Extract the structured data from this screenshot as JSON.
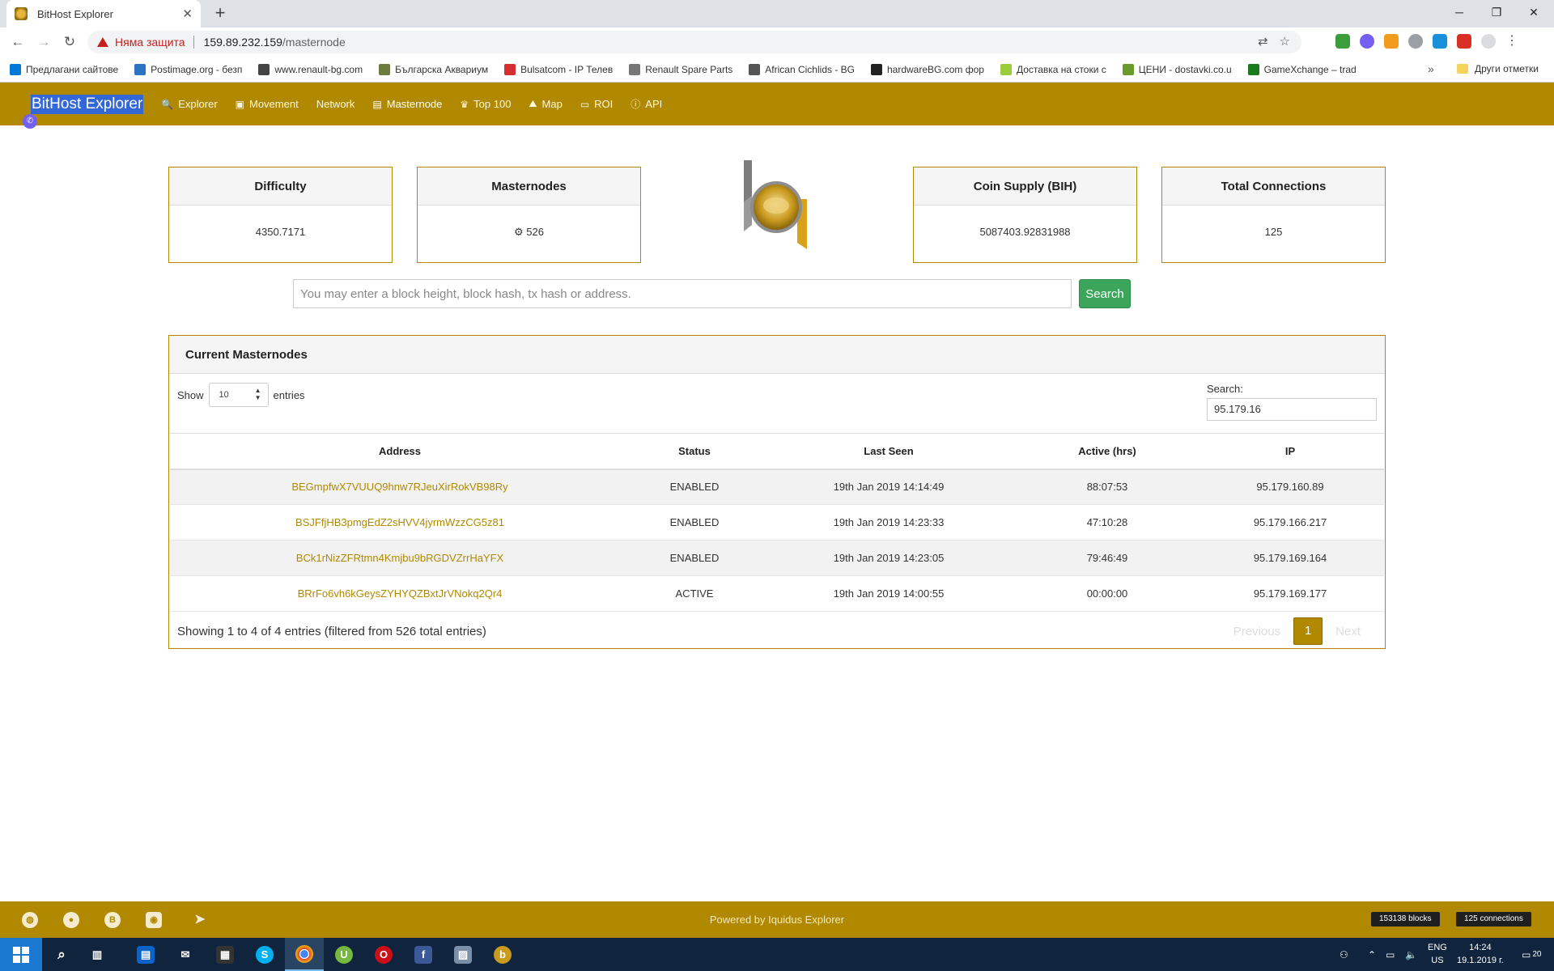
{
  "browser": {
    "tab_title": "BitHost Explorer",
    "new_tab_glyph": "+",
    "insecure_label": "Няма защита",
    "url_host": "159.89.232.159",
    "url_path": "/masternode",
    "bookmarks": [
      {
        "label": "Предлагани сайтове",
        "icon_color": "#0078d7"
      },
      {
        "label": "Postimage.org - безп",
        "icon_color": "#2a73c5"
      },
      {
        "label": "www.renault-bg.com",
        "icon_color": "#444444"
      },
      {
        "label": "Българска Аквариум",
        "icon_color": "#6c7c3c"
      },
      {
        "label": "Bulsatcom - IP Телев",
        "icon_color": "#d32f2f"
      },
      {
        "label": "Renault Spare Parts",
        "icon_color": "#777777"
      },
      {
        "label": "African Cichlids - BG",
        "icon_color": "#555555"
      },
      {
        "label": "hardwareBG.com фор",
        "icon_color": "#222222"
      },
      {
        "label": "Доставка на стоки с",
        "icon_color": "#9ccc3c"
      },
      {
        "label": "ЦЕНИ - dostavki.co.u",
        "icon_color": "#6a9a2a"
      },
      {
        "label": "GameXchange – trad",
        "icon_color": "#1b7a1b"
      }
    ],
    "bookmarks_more": "»",
    "other_bookmarks": "Други отметки"
  },
  "navbar": {
    "brand": "BitHost Explorer",
    "items": [
      {
        "label": "Explorer",
        "icon": "search-icon",
        "glyph": "🔍"
      },
      {
        "label": "Movement",
        "icon": "money-icon",
        "glyph": "💵"
      },
      {
        "label": "Network",
        "icon": "",
        "glyph": ""
      },
      {
        "label": "Masternode",
        "icon": "server-icon",
        "glyph": "▤"
      },
      {
        "label": "Top 100",
        "icon": "crown-icon",
        "glyph": "♛"
      },
      {
        "label": "Map",
        "icon": "map-icon",
        "glyph": "⛰"
      },
      {
        "label": "ROI",
        "icon": "roi-icon",
        "glyph": "▭"
      },
      {
        "label": "API",
        "icon": "info-icon",
        "glyph": "ⓘ"
      }
    ]
  },
  "stats": {
    "difficulty": {
      "title": "Difficulty",
      "value": "4350.7171"
    },
    "masternodes": {
      "title": "Masternodes",
      "value": "526",
      "icon": "gears-icon"
    },
    "coin_supply": {
      "title": "Coin Supply (BIH)",
      "value": "5087403.92831988"
    },
    "connections": {
      "title": "Total Connections",
      "value": "125"
    }
  },
  "search": {
    "placeholder": "You may enter a block height, block hash, tx hash or address.",
    "button": "Search"
  },
  "masternodes_table": {
    "title": "Current Masternodes",
    "show_label": "Show",
    "page_length": "10",
    "entries_label": "entries",
    "filter_label": "Search:",
    "filter_value": "95.179.16",
    "columns": [
      "Address",
      "Status",
      "Last Seen",
      "Active (hrs)",
      "IP"
    ],
    "rows": [
      {
        "address": "BEGmpfwX7VUUQ9hnw7RJeuXirRokVB98Ry",
        "status": "ENABLED",
        "last_seen": "19th Jan 2019 14:14:49",
        "active": "88:07:53",
        "ip": "95.179.160.89"
      },
      {
        "address": "BSJFfjHB3pmgEdZ2sHVV4jyrmWzzCG5z81",
        "status": "ENABLED",
        "last_seen": "19th Jan 2019 14:23:33",
        "active": "47:10:28",
        "ip": "95.179.166.217"
      },
      {
        "address": "BCk1rNizZFRtmn4Kmjbu9bRGDVZrrHaYFX",
        "status": "ENABLED",
        "last_seen": "19th Jan 2019 14:23:05",
        "active": "79:46:49",
        "ip": "95.179.169.164"
      },
      {
        "address": "BRrFo6vh6kGeysZYHYQZBxtJrVNokq2Qr4",
        "status": "ACTIVE",
        "last_seen": "19th Jan 2019 14:00:55",
        "active": "00:00:00",
        "ip": "95.179.169.177"
      }
    ],
    "info": "Showing 1 to 4 of 4 entries (filtered from 526 total entries)",
    "pager": {
      "previous": "Previous",
      "current": "1",
      "next": "Next"
    }
  },
  "footer": {
    "powered": "Powered by Iquidus Explorer",
    "blocks": "153138 blocks",
    "connections": "125 connections"
  },
  "taskbar": {
    "lang_top": "ENG",
    "lang_bottom": "US",
    "time": "14:24",
    "date": "19.1.2019 г.",
    "notifications": "20"
  },
  "colors": {
    "brand": "#b18900",
    "search_button": "#3ca55c",
    "link": "#b18900"
  }
}
